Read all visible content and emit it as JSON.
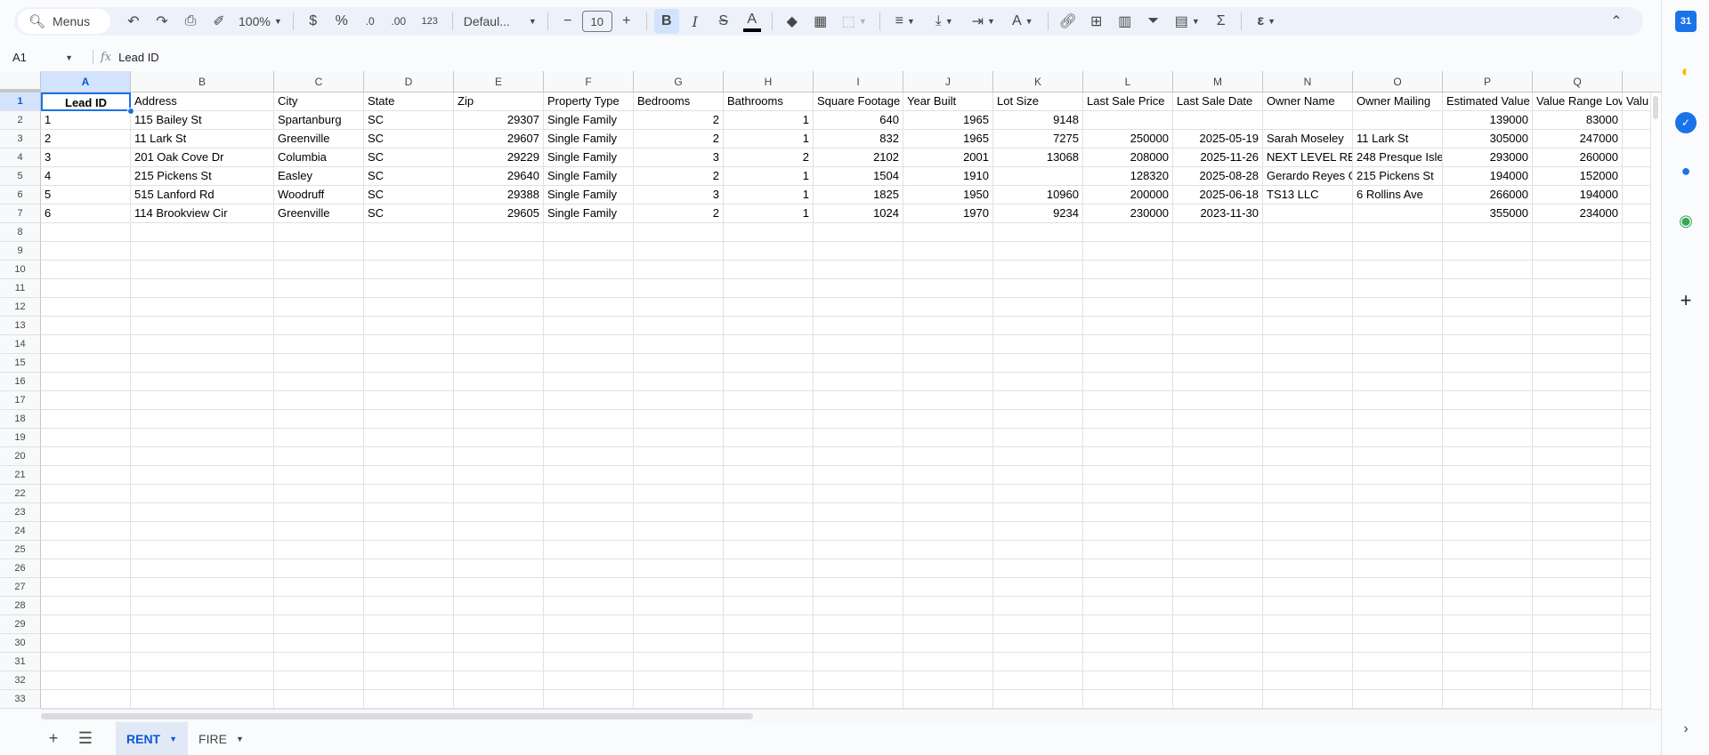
{
  "toolbar": {
    "menus_label": "Menus",
    "zoom": "100%",
    "currency": "$",
    "percent": "%",
    "decrease_decimal": ".0",
    "increase_decimal": ".00",
    "number_format": "123",
    "font": "Defaul...",
    "font_size": "10",
    "bold": "B",
    "italic": "I",
    "strike": "S",
    "text_color": "A",
    "text_rotate": "A",
    "functions": "Σ",
    "gemini": "ε"
  },
  "formula_bar": {
    "name_box": "A1",
    "fx": "fx",
    "content": "Lead ID"
  },
  "grid": {
    "col_letters": [
      "A",
      "B",
      "C",
      "D",
      "E",
      "F",
      "G",
      "H",
      "I",
      "J",
      "K",
      "L",
      "M",
      "N",
      "O",
      "P",
      "Q",
      ""
    ],
    "row_numbers": [
      "1",
      "2",
      "3",
      "4",
      "5",
      "6",
      "7",
      "8",
      "9",
      "10",
      "11",
      "12",
      "13",
      "14",
      "15",
      "16",
      "17",
      "18",
      "19",
      "20",
      "21",
      "22",
      "23",
      "24",
      "25",
      "26",
      "27",
      "28",
      "29",
      "30",
      "31",
      "32",
      "33"
    ],
    "headers": [
      "Lead ID",
      "Address",
      "City",
      "State",
      "Zip",
      "Property Type",
      "Bedrooms",
      "Bathrooms",
      "Square Footage",
      "Year Built",
      "Lot Size",
      "Last Sale Price",
      "Last Sale Date",
      "Owner Name",
      "Owner Mailing",
      "Estimated Value",
      "Value Range Low",
      "Valu"
    ],
    "numeric": [
      false,
      false,
      false,
      false,
      true,
      false,
      true,
      true,
      true,
      true,
      true,
      true,
      true,
      false,
      false,
      true,
      true,
      true
    ],
    "rows": [
      [
        "1",
        "115 Bailey St",
        "Spartanburg",
        "SC",
        "29307",
        "Single Family",
        "2",
        "1",
        "640",
        "1965",
        "9148",
        "",
        "",
        "",
        "",
        "139000",
        "83000",
        ""
      ],
      [
        "2",
        "11 Lark St",
        "Greenville",
        "SC",
        "29607",
        "Single Family",
        "2",
        "1",
        "832",
        "1965",
        "7275",
        "250000",
        "2025-05-19",
        "Sarah Moseley",
        "11 Lark St",
        "305000",
        "247000",
        ""
      ],
      [
        "3",
        "201 Oak Cove Dr",
        "Columbia",
        "SC",
        "29229",
        "Single Family",
        "3",
        "2",
        "2102",
        "2001",
        "13068",
        "208000",
        "2025-11-26",
        "NEXT LEVEL REAL ESTATE",
        "248 Presque Isle",
        "293000",
        "260000",
        ""
      ],
      [
        "4",
        "215 Pickens St",
        "Easley",
        "SC",
        "29640",
        "Single Family",
        "2",
        "1",
        "1504",
        "1910",
        "",
        "128320",
        "2025-08-28",
        "Gerardo Reyes Garcia",
        "215 Pickens St",
        "194000",
        "152000",
        ""
      ],
      [
        "5",
        "515 Lanford Rd",
        "Woodruff",
        "SC",
        "29388",
        "Single Family",
        "3",
        "1",
        "1825",
        "1950",
        "10960",
        "200000",
        "2025-06-18",
        "TS13 LLC",
        "6 Rollins Ave",
        "266000",
        "194000",
        ""
      ],
      [
        "6",
        "114 Brookview Cir",
        "Greenville",
        "SC",
        "29605",
        "Single Family",
        "2",
        "1",
        "1024",
        "1970",
        "9234",
        "230000",
        "2023-11-30",
        "",
        "",
        "355000",
        "234000",
        ""
      ]
    ]
  },
  "sheets": [
    {
      "name": "RENT",
      "active": true
    },
    {
      "name": "FIRE",
      "active": false
    }
  ],
  "side_panel": {
    "calendar_label": "31"
  }
}
